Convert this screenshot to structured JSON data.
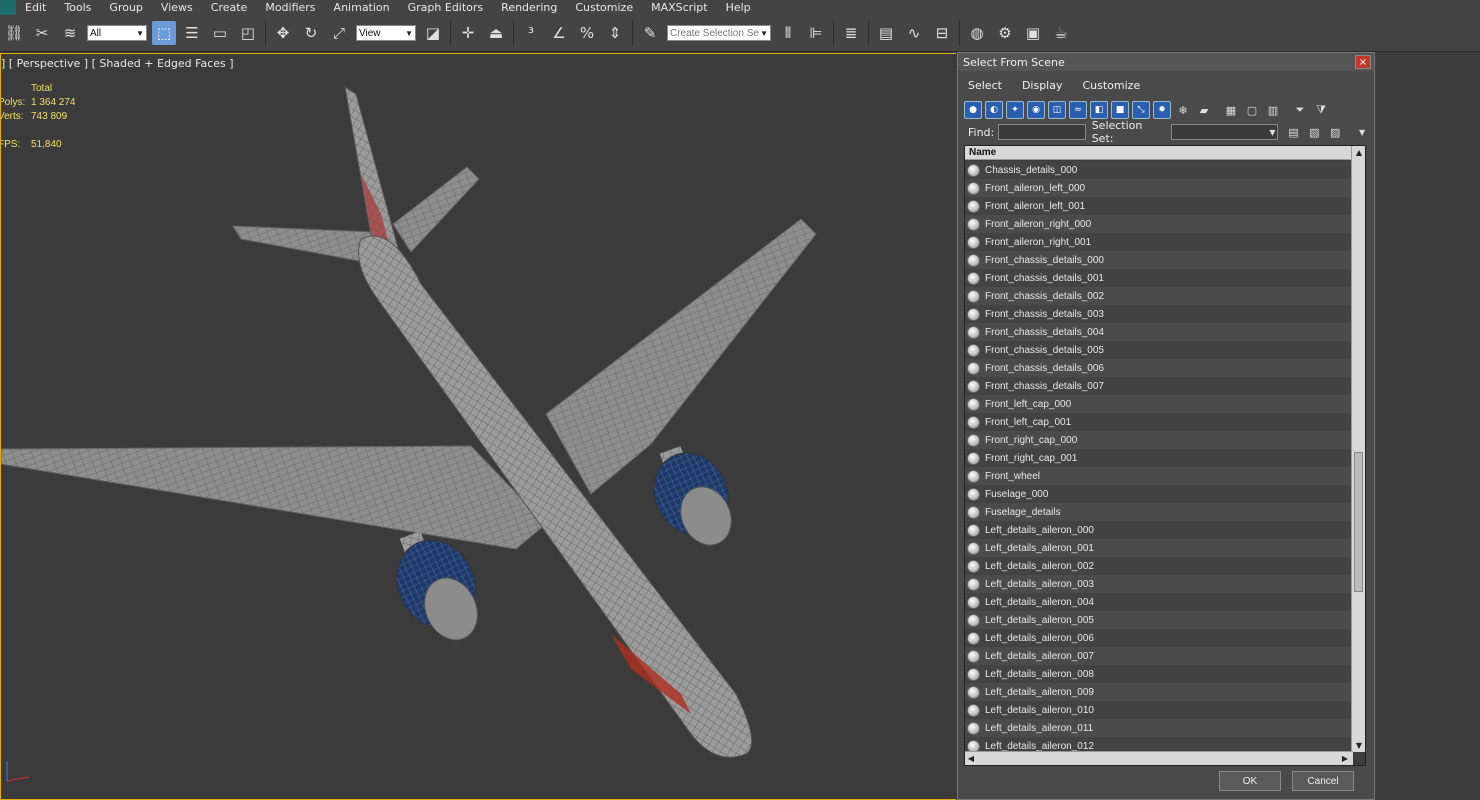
{
  "menu": [
    "Edit",
    "Tools",
    "Group",
    "Views",
    "Create",
    "Modifiers",
    "Animation",
    "Graph Editors",
    "Rendering",
    "Customize",
    "MAXScript",
    "Help"
  ],
  "toolbar": {
    "filter_value": "All",
    "ref_coord_value": "View",
    "selection_set_placeholder": "Create Selection Se"
  },
  "viewport": {
    "label": "] [ Perspective ] [ Shaded + Edged Faces ]",
    "stats": {
      "header": "Total",
      "polys_label": "Polys:",
      "polys_value": "1 364 274",
      "verts_label": "Verts:",
      "verts_value": "743 809",
      "fps_label": "FPS:",
      "fps_value": "51,840"
    }
  },
  "dialog": {
    "title": "Select From Scene",
    "close_label": "×",
    "menu": [
      "Select",
      "Display",
      "Customize"
    ],
    "find_label": "Find:",
    "find_value": "",
    "selection_set_label": "Selection Set:",
    "column_header": "Name",
    "items": [
      "Chassis_details_000",
      "Front_aileron_left_000",
      "Front_aileron_left_001",
      "Front_aileron_right_000",
      "Front_aileron_right_001",
      "Front_chassis_details_000",
      "Front_chassis_details_001",
      "Front_chassis_details_002",
      "Front_chassis_details_003",
      "Front_chassis_details_004",
      "Front_chassis_details_005",
      "Front_chassis_details_006",
      "Front_chassis_details_007",
      "Front_left_cap_000",
      "Front_left_cap_001",
      "Front_right_cap_000",
      "Front_right_cap_001",
      "Front_wheel",
      "Fuselage_000",
      "Fuselage_details",
      "Left_details_aileron_000",
      "Left_details_aileron_001",
      "Left_details_aileron_002",
      "Left_details_aileron_003",
      "Left_details_aileron_004",
      "Left_details_aileron_005",
      "Left_details_aileron_006",
      "Left_details_aileron_007",
      "Left_details_aileron_008",
      "Left_details_aileron_009",
      "Left_details_aileron_010",
      "Left_details_aileron_011",
      "Left_details_aileron_012"
    ],
    "ok_label": "OK",
    "cancel_label": "Cancel"
  },
  "colors": {
    "stats_text": "#f0e060",
    "viewport_border": "#e0b000",
    "active_tool": "#6a9bd8"
  }
}
